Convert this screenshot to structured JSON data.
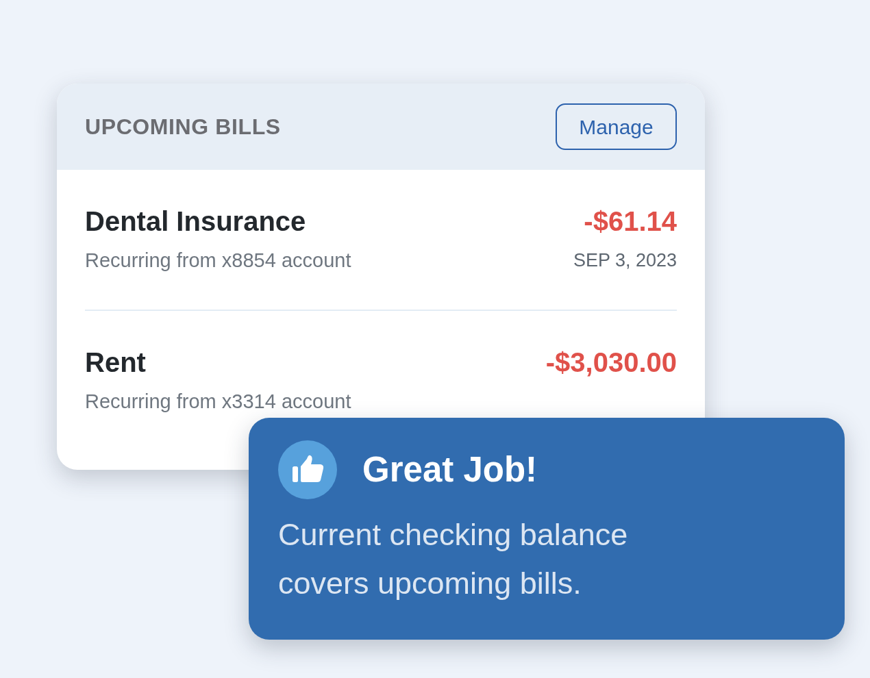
{
  "card": {
    "title": "UPCOMING BILLS",
    "button": "Manage",
    "bills": [
      {
        "name": "Dental Insurance",
        "amount": "-$61.14",
        "detail": "Recurring from x8854 account",
        "date": "SEP 3, 2023"
      },
      {
        "name": "Rent",
        "amount": "-$3,030.00",
        "detail": "Recurring from x3314 account"
      }
    ]
  },
  "toast": {
    "title": "Great Job!",
    "message": "Current checking balance covers upcoming bills."
  }
}
